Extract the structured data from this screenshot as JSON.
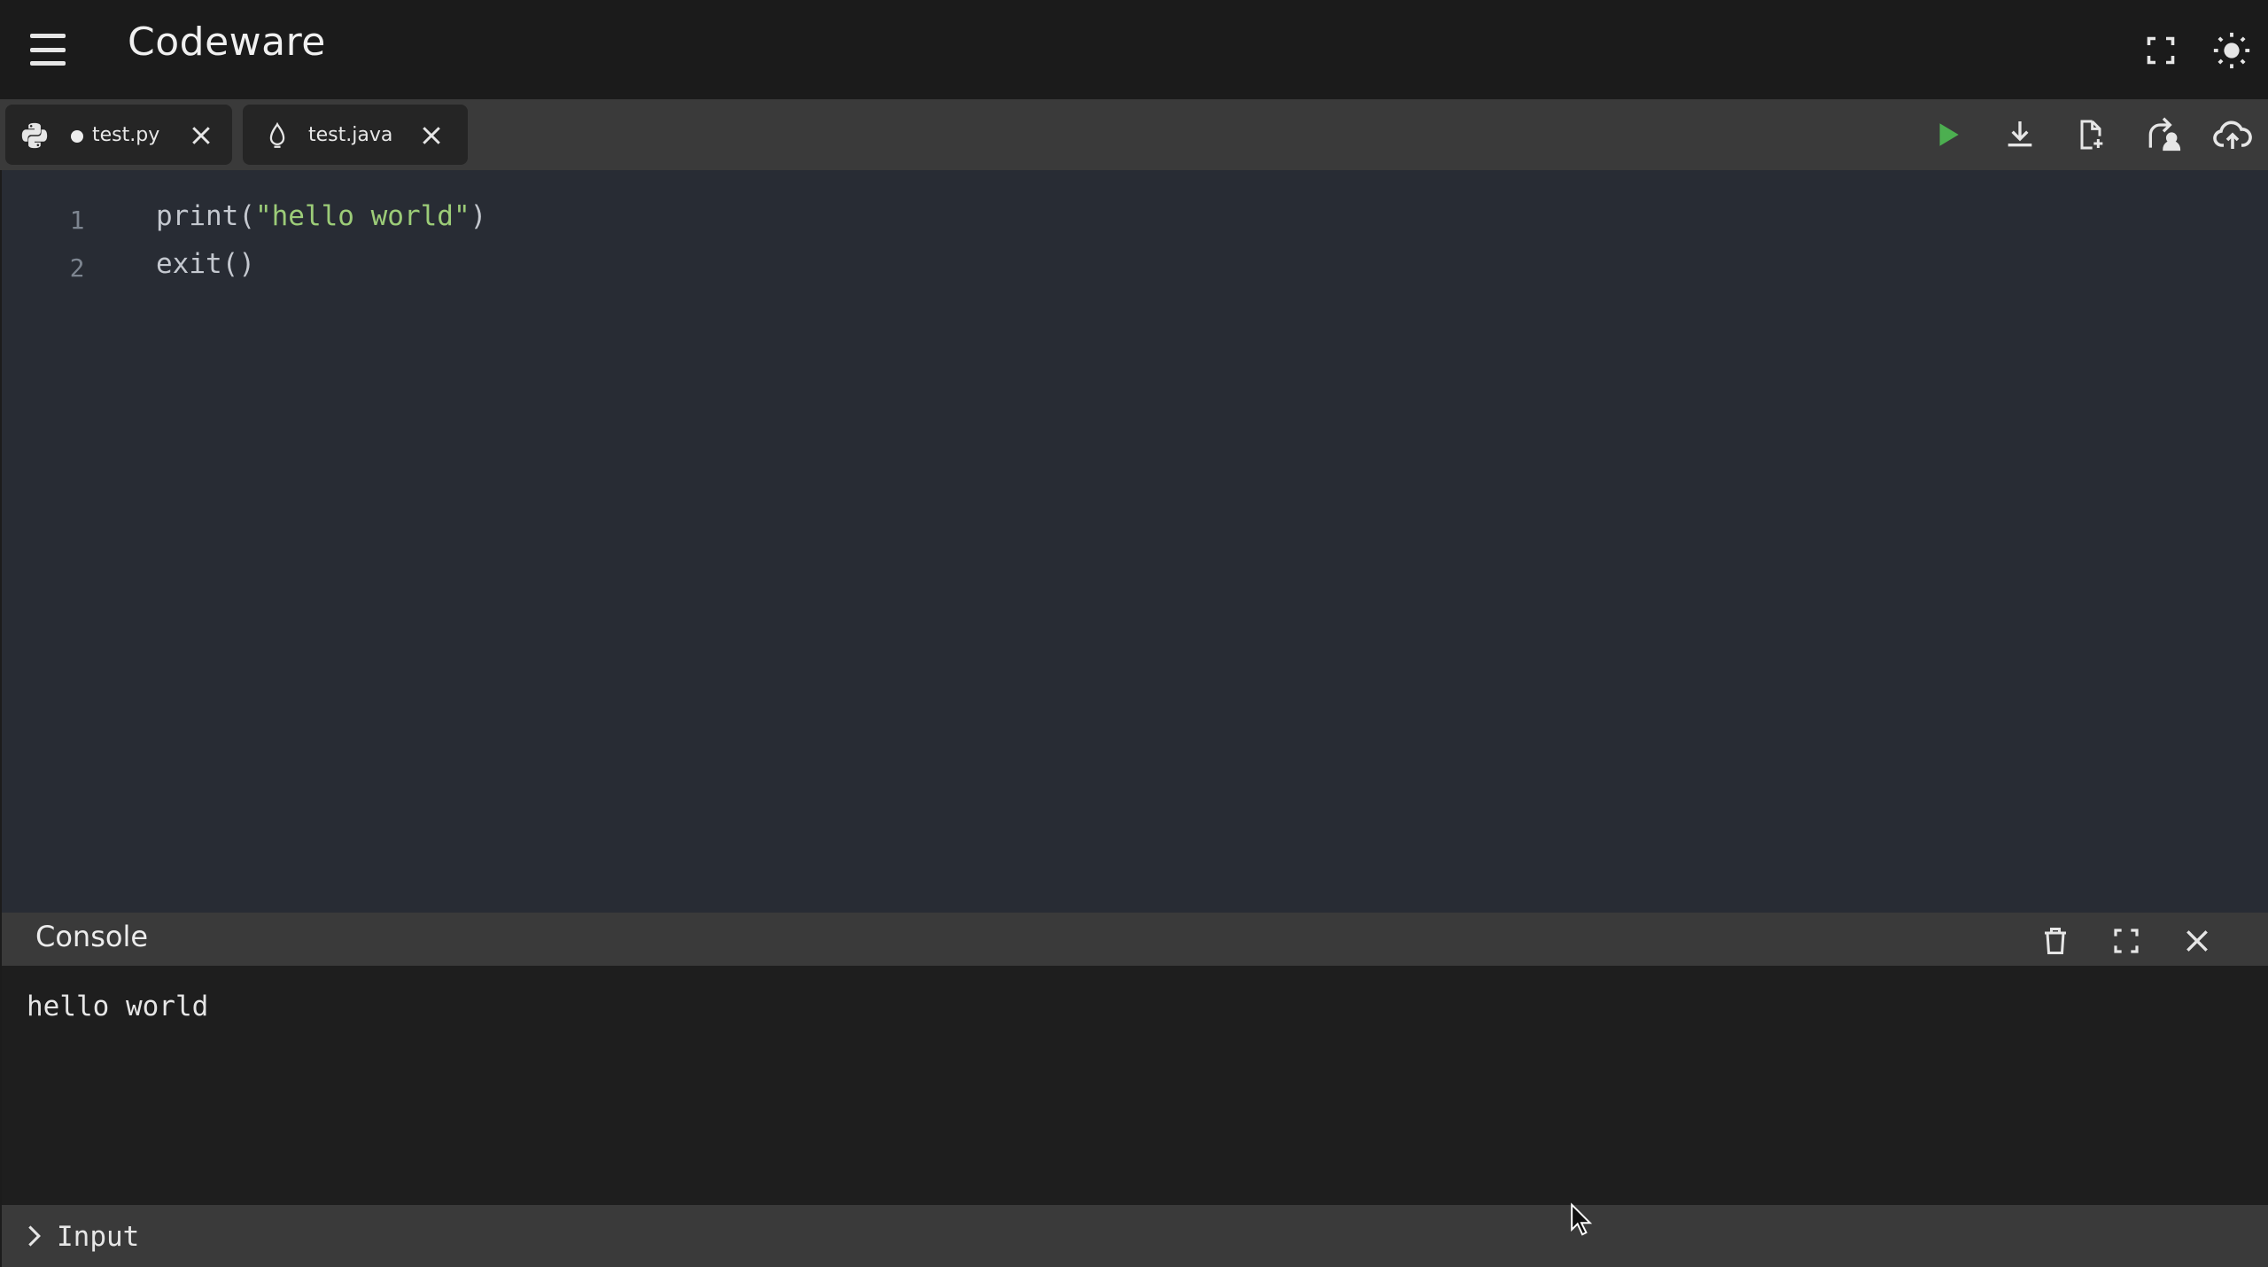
{
  "app": {
    "title": "Codeware"
  },
  "header_icons": {
    "menu": "menu-icon",
    "fullscreen": "fullscreen-icon",
    "theme": "sun-icon"
  },
  "tabs": [
    {
      "label": "test.py",
      "icon": "python-icon",
      "unsaved": true
    },
    {
      "label": "test.java",
      "icon": "java-icon",
      "unsaved": false
    }
  ],
  "toolbar": {
    "run": "play-icon",
    "download": "download-icon",
    "new_file": "new-file-icon",
    "share": "share-icon",
    "upload": "cloud-upload-icon",
    "run_color": "#4caf50"
  },
  "editor": {
    "lines": [
      {
        "number": "1",
        "prefix": "print(",
        "string": "\"hello world\"",
        "suffix": ")"
      },
      {
        "number": "2",
        "prefix": "exit()",
        "string": "",
        "suffix": ""
      }
    ]
  },
  "console": {
    "title": "Console",
    "output": "hello world",
    "input_placeholder": "Input"
  },
  "colors": {
    "editor_bg": "#282c34",
    "string": "#9ccc78",
    "panel": "#3a3a3a"
  }
}
